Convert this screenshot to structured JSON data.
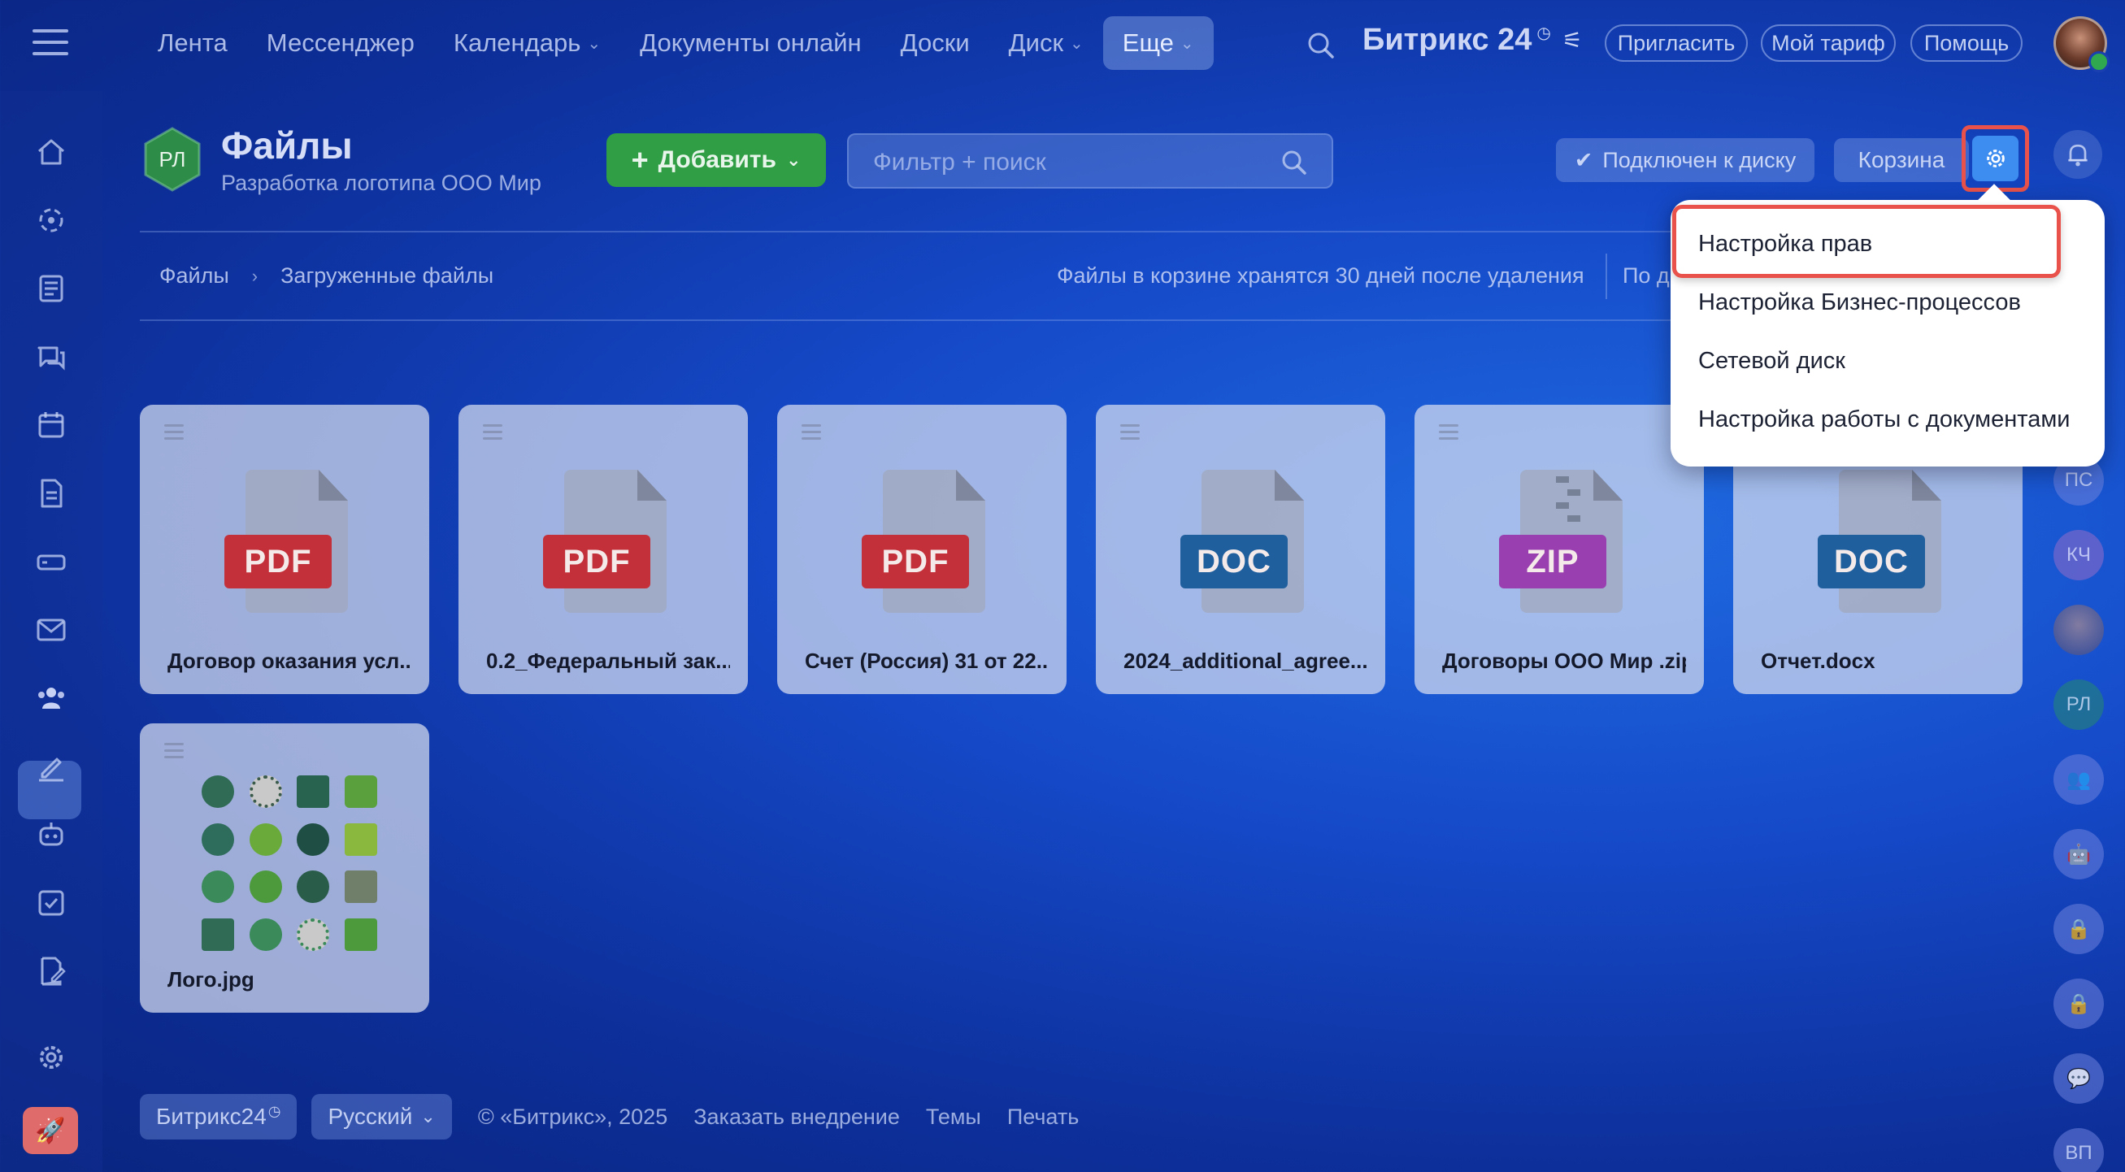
{
  "topnav": {
    "items": [
      {
        "label": "Лента",
        "dropdown": false
      },
      {
        "label": "Мессенджер",
        "dropdown": false
      },
      {
        "label": "Календарь",
        "dropdown": true
      },
      {
        "label": "Документы онлайн",
        "dropdown": false
      },
      {
        "label": "Доски",
        "dropdown": false
      },
      {
        "label": "Диск",
        "dropdown": true
      },
      {
        "label": "Еще",
        "dropdown": true,
        "active": true
      }
    ],
    "brand": "Битрикс 24",
    "invite_label": "Пригласить",
    "tariff_label": "Мой тариф",
    "help_label": "Помощь"
  },
  "header": {
    "logo_initials": "РЛ",
    "title": "Файлы",
    "subtitle": "Разработка логотипа ООО Мир",
    "add_label": "Добавить",
    "search_placeholder": "Фильтр + поиск",
    "connected_label": "Подключен к диску",
    "trash_label": "Корзина"
  },
  "breadcrumb": {
    "items": [
      "Файлы",
      "Загруженные файлы"
    ]
  },
  "notice": "Файлы в корзине хранятся 30 дней после удаления",
  "sort_label": "По д",
  "files": [
    {
      "name": "Договор оказания усл...",
      "type": "PDF",
      "color": "#c4303a"
    },
    {
      "name": "0.2_Федеральный зак...",
      "type": "PDF",
      "color": "#c4303a"
    },
    {
      "name": "Счет (Россия) 31 от 22...",
      "type": "PDF",
      "color": "#c4303a"
    },
    {
      "name": "2024_additional_agree...",
      "type": "DOC",
      "color": "#1f5f9e"
    },
    {
      "name": "Договоры ООО Мир .zip",
      "type": "ZIP",
      "color": "#9a3fb0"
    },
    {
      "name": "Отчет.docx",
      "type": "DOC",
      "color": "#1f5f9e"
    },
    {
      "name": "Лого.jpg",
      "type": "image",
      "color": ""
    }
  ],
  "settings_menu": {
    "items": [
      "Настройка прав",
      "Настройка Бизнес-процессов",
      "Сетевой диск",
      "Настройка работы с документами"
    ],
    "highlighted_index": 0
  },
  "right_bar": {
    "initials": [
      "ПС",
      "КЧ",
      "РЛ",
      "ВП"
    ]
  },
  "footer": {
    "brand_label": "Битрикс24",
    "language_label": "Русский",
    "copyright": "© «Битрикс», 2025",
    "links": [
      "Заказать внедрение",
      "Темы",
      "Печать"
    ]
  },
  "colors": {
    "accent_green": "#2f9e45",
    "accent_blue": "#3d8cf0",
    "highlight_red": "#e8524a"
  }
}
